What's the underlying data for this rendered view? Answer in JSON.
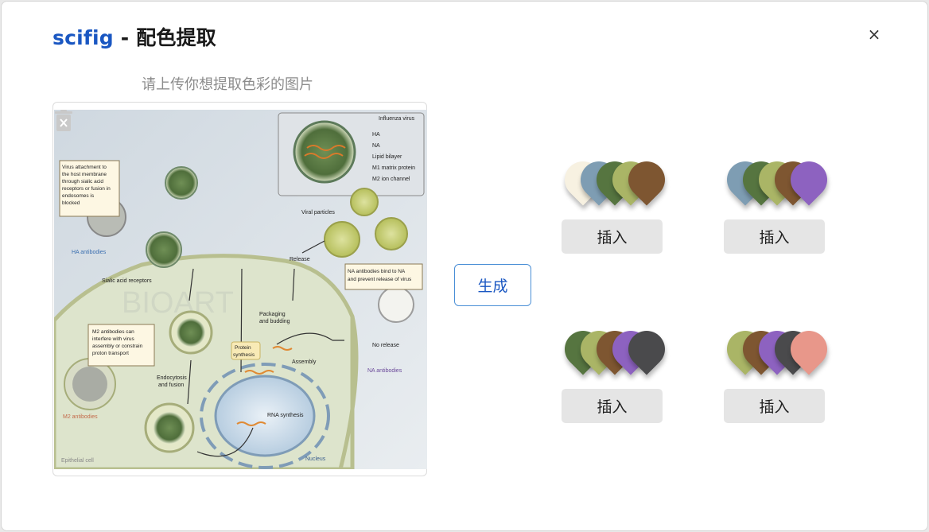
{
  "dialog": {
    "brand": "scifig",
    "title_rest": " - 配色提取",
    "close_label": "×"
  },
  "upload": {
    "hint": "请上传你想提取色彩的图片",
    "image_text": {
      "influenza_virus": "Influenza virus",
      "ha": "HA",
      "na": "NA",
      "lipid_bilayer": "Lipid bilayer",
      "m1": "M1 matrix protein",
      "m2": "M2 ion channel",
      "viral_particles": "Viral particles",
      "release": "Release",
      "attach_note": [
        "Virus attachment to",
        "the host membrane",
        "through sialic acid",
        "receptors or fusion in",
        "endosomes is",
        "blocked"
      ],
      "ha_antibodies": "HA antibodies",
      "sialic": "Sialic acid receptors",
      "na_note": [
        "NA antibodies bind to NA",
        "and prevent release of virus"
      ],
      "packaging": [
        "Packaging",
        "and budding"
      ],
      "m2_note": [
        "M2 antibodies can",
        "interfere with virus",
        "assembly or constrain",
        "proton transport"
      ],
      "protein_synth": [
        "Protein",
        "synthesis"
      ],
      "assembly": "Assembly",
      "no_release": "No release",
      "na_antibodies": "NA antibodies",
      "endocytosis": [
        "Endocytosis",
        "and fusion"
      ],
      "m2_antibodies": "M2 antibodies",
      "rna_synth": "RNA synthesis",
      "nucleus": "Nucleus",
      "epithelial": "Epithelial cell",
      "watermark": "BIOART"
    }
  },
  "generate_label": "生成",
  "palettes": [
    {
      "colors": [
        "#f7f1e1",
        "#7e9db3",
        "#567540",
        "#aab566",
        "#7e5631"
      ],
      "insert_label": "插入"
    },
    {
      "colors": [
        "#7e9db3",
        "#567540",
        "#aab566",
        "#7e5631",
        "#8d62c0"
      ],
      "insert_label": "插入"
    },
    {
      "colors": [
        "#567540",
        "#aab566",
        "#7e5631",
        "#8d62c0",
        "#4a4a4c"
      ],
      "insert_label": "插入"
    },
    {
      "colors": [
        "#aab566",
        "#7e5631",
        "#8d62c0",
        "#4a4a4c",
        "#e8978a"
      ],
      "insert_label": "插入"
    }
  ]
}
